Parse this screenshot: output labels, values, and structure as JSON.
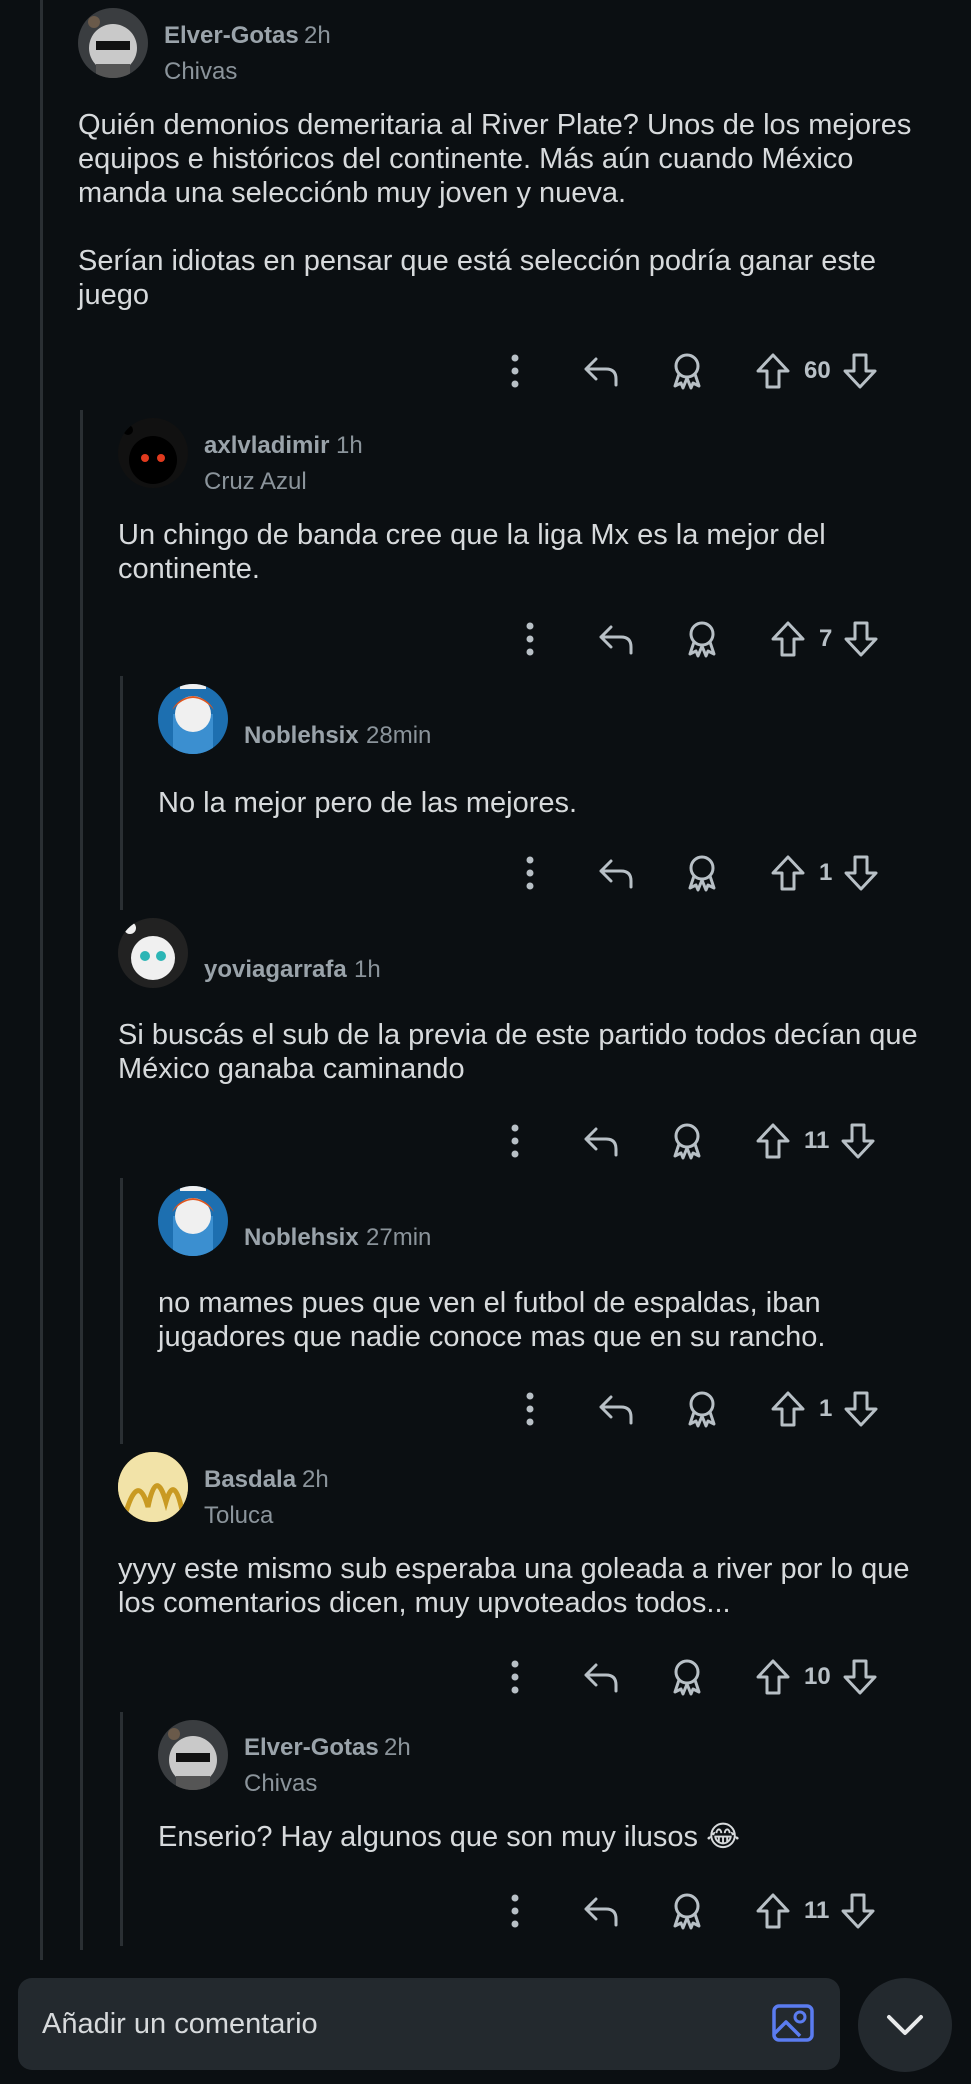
{
  "comments": [
    {
      "user": "Elver-Gotas",
      "time": "2h",
      "flair": "Chivas",
      "body": "Quién demonios demeritaria al River Plate? Unos de los mejores equipos e históricos del continente. Más aún cuando México manda una selecciónb muy joven y nueva.\n\nSerían idiotas en pensar que está selección podría ganar este juego",
      "votes": "60"
    },
    {
      "user": "axlvladimir",
      "time": "1h",
      "flair": "Cruz Azul",
      "body": "Un chingo de banda cree que la liga Mx es la mejor del continente.",
      "votes": "7"
    },
    {
      "user": "Noblehsix",
      "time": "28min",
      "flair": "",
      "body": "No la mejor pero de las mejores.",
      "votes": "1"
    },
    {
      "user": "yoviagarrafa",
      "time": "1h",
      "flair": "",
      "body": "Si buscás el sub de la previa de este partido todos decían que México ganaba caminando",
      "votes": "11"
    },
    {
      "user": "Noblehsix",
      "time": "27min",
      "flair": "",
      "body": "no mames pues que ven el futbol de espaldas, iban jugadores que nadie conoce mas que en su rancho.",
      "votes": "1"
    },
    {
      "user": "Basdala",
      "time": "2h",
      "flair": "Toluca",
      "body": "yyyy este mismo sub esperaba una goleada a river por lo que los comentarios dicen, muy upvoteados todos...",
      "votes": "10"
    },
    {
      "user": "Elver-Gotas",
      "time": "2h",
      "flair": "Chivas",
      "body": "Enserio? Hay algunos que son muy ilusos 😂",
      "votes": "11"
    }
  ],
  "composer": {
    "placeholder": "Añadir un comentario",
    "image_icon": "image-icon",
    "collapse_icon": "chevron-down-icon"
  },
  "colors": {
    "background": "#0b0f12",
    "input_background": "#23292e",
    "image_icon_accent": "#5b7cf0"
  }
}
